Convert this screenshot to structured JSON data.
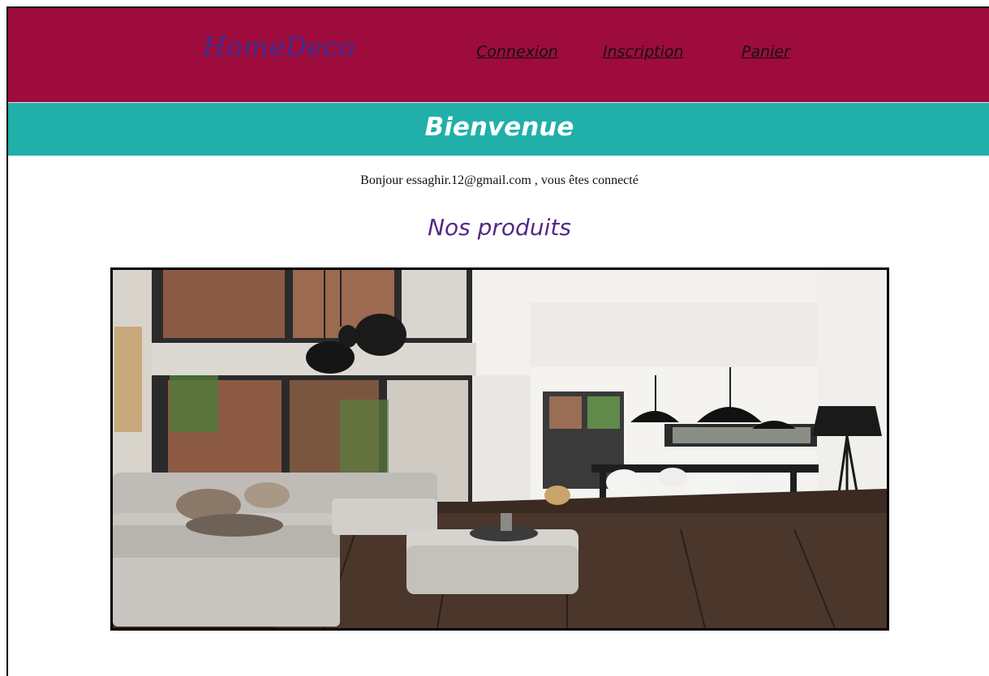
{
  "header": {
    "logo": "HomeDeco",
    "nav": {
      "connexion": "Connexion",
      "inscription": "Inscription",
      "panier": "Panier"
    }
  },
  "welcome": {
    "title": "Bienvenue"
  },
  "main": {
    "greeting": "Bonjour essaghir.12@gmail.com , vous êtes connecté",
    "products_title": "Nos produits",
    "product_image": "living-room-photo"
  },
  "colors": {
    "header_bg": "#9d0c3d",
    "logo": "#3f2a8e",
    "welcome_bg": "#20b0a9",
    "products_title": "#55288a"
  }
}
